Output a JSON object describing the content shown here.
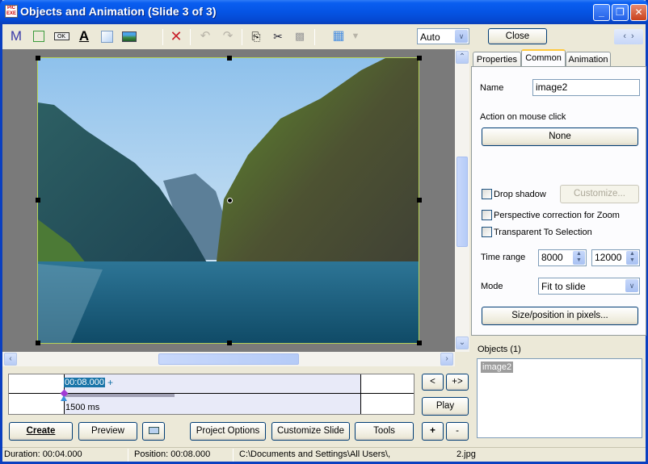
{
  "window": {
    "title": "Objects and Animation  (Slide 3 of 3)",
    "app_icon_text": "PIC EXE",
    "controls": {
      "minimize": "_",
      "restore": "❐",
      "close": "✕"
    }
  },
  "toolbar": {
    "tools": [
      {
        "name": "text-object-icon",
        "glyph": "M"
      },
      {
        "name": "frame-icon",
        "glyph": ""
      },
      {
        "name": "button-icon",
        "glyph": "OK"
      },
      {
        "name": "text-icon",
        "glyph": "A"
      },
      {
        "name": "rectangle-icon",
        "glyph": ""
      },
      {
        "name": "image-icon",
        "glyph": ""
      },
      {
        "name": "delete-icon",
        "glyph": "✕"
      },
      {
        "name": "undo-icon",
        "glyph": "↶"
      },
      {
        "name": "redo-icon",
        "glyph": "↷"
      },
      {
        "name": "copy-icon",
        "glyph": "⎘"
      },
      {
        "name": "cut-icon",
        "glyph": "✂"
      },
      {
        "name": "paste-icon",
        "glyph": "📋"
      },
      {
        "name": "grid-icon",
        "glyph": "▦"
      },
      {
        "name": "grid-dropdown-icon",
        "glyph": "▾"
      }
    ],
    "zoom_select": {
      "value": "Auto"
    },
    "close_label": "Close",
    "nav": {
      "prev": "‹",
      "next": "›"
    }
  },
  "properties_panel": {
    "tabs": [
      {
        "label": "Properties",
        "active": false
      },
      {
        "label": "Common",
        "active": true
      },
      {
        "label": "Animation",
        "active": false
      }
    ],
    "name_label": "Name",
    "name_value": "image2",
    "action_label": "Action on mouse click",
    "action_value": "None",
    "drop_shadow": {
      "label": "Drop shadow",
      "checked": false
    },
    "customize_label": "Customize...",
    "perspective": {
      "label": "Perspective correction for Zoom",
      "checked": false
    },
    "transparent": {
      "label": "Transparent To Selection",
      "checked": false
    },
    "time_range_label": "Time range",
    "time_range_start": "8000",
    "time_range_end": "12000",
    "mode_label": "Mode",
    "mode_value": "Fit to slide",
    "size_position_label": "Size/position in pixels..."
  },
  "objects": {
    "label": "Objects (1)",
    "items": [
      "image2"
    ]
  },
  "timeline": {
    "position_label": "00:08.000",
    "plus": "+",
    "duration_label": "1500 ms",
    "prev_label": "<",
    "next_label": "+>",
    "play_label": "Play"
  },
  "bottom_buttons": {
    "create": "Create",
    "preview": "Preview",
    "project_options": "Project Options",
    "customize_slide": "Customize Slide",
    "tools": "Tools",
    "add": "+",
    "remove": "-"
  },
  "status_bar": {
    "duration": "Duration:  00:04.000",
    "position": "Position:  00:08.000",
    "path": "C:\\Documents and Settings\\All Users\\,",
    "file": "2.jpg"
  }
}
